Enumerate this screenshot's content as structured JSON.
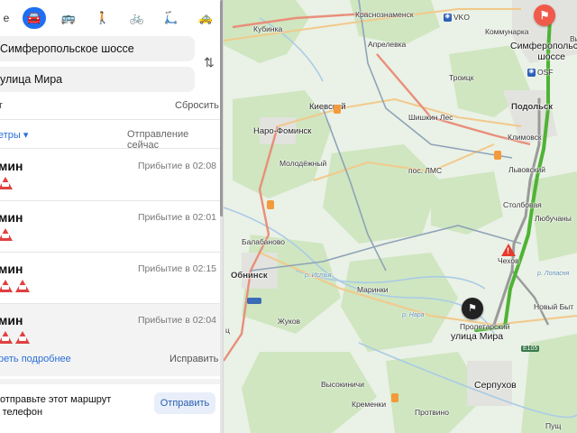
{
  "modes": {
    "cut_label": "е",
    "items": [
      {
        "name": "car",
        "glyph": "🚘"
      },
      {
        "name": "bus",
        "glyph": "🚌"
      },
      {
        "name": "walk",
        "glyph": "🚶"
      },
      {
        "name": "bike",
        "glyph": "🚲"
      },
      {
        "name": "scooter",
        "glyph": "🛴"
      },
      {
        "name": "taxi",
        "glyph": "🚕"
      }
    ]
  },
  "route_form": {
    "from_value": "Симферопольское шоссе",
    "to_value": "улица Мира",
    "add_point_partial": "т",
    "reset_label": "Сбросить",
    "swap_glyph": "⇅",
    "params_label": "етры",
    "departure_label": "Отправление сейчас"
  },
  "routes": [
    {
      "time": "мин",
      "arrival": "Прибытие в 02:08",
      "warnings": 1,
      "selected": false
    },
    {
      "time": "мин",
      "arrival": "Прибытие в 02:01",
      "warnings": 1,
      "selected": false
    },
    {
      "time": "мин",
      "arrival": "Прибытие в 02:15",
      "warnings": 2,
      "selected": false
    },
    {
      "time": "мин",
      "arrival": "Прибытие в 02:04",
      "warnings": 2,
      "selected": true
    }
  ],
  "route_actions": {
    "more_label": "реть подробнее",
    "fix_label": "Исправить"
  },
  "send_card": {
    "text_line1": "отправьте этот маршрут",
    "text_line2": "телефон",
    "button_label": "Отправить"
  },
  "map": {
    "end_label_line1": "Симферопольское",
    "end_label_line2": "шоссе",
    "start_label": "улица Мира",
    "labels": {
      "krasnoznamensk": "Краснознаменск",
      "vko": "VKO",
      "kubinka": "Кубинка",
      "aprelevka": "Апрелевка",
      "kommunarka": "Коммунарка",
      "osf": "OSF",
      "troitsk": "Троицк",
      "kievsky": "Киевский",
      "shishkin": "Шишкин Лес",
      "podolsk": "Подольск",
      "naro": "Наро-Фоминск",
      "klimovsk": "Климовск",
      "molod": "Молодёжный",
      "lms": "пос. ЛМС",
      "lvovsky": "Львовский",
      "stolbovaya": "Столбовая",
      "lyubuchany": "Любучаны",
      "balabanovo": "Балабаново",
      "chekhov": "Чехов",
      "obninsk": "Обнинск",
      "marinki": "Маринки",
      "novy_byt": "Новый Быт",
      "zhukov": "Жуков",
      "proletarsky": "Пролетарский",
      "serpukhov": "Серпухов",
      "vysokinichi": "Высокиничи",
      "kremenki": "Кременки",
      "protvino": "Протвино",
      "pushch": "Пущ",
      "vi": "Ви",
      "tsy": "ц",
      "nara": "р. Нара",
      "istya": "р. Истья",
      "lopasnya": "р. Лопасня",
      "m3": "M-3",
      "e105": "E105"
    }
  },
  "colors": {
    "accent": "#1f6ff2",
    "route_main": "#4fb335",
    "route_alt": "#9a9a9a",
    "end_marker": "#f05a4a"
  }
}
